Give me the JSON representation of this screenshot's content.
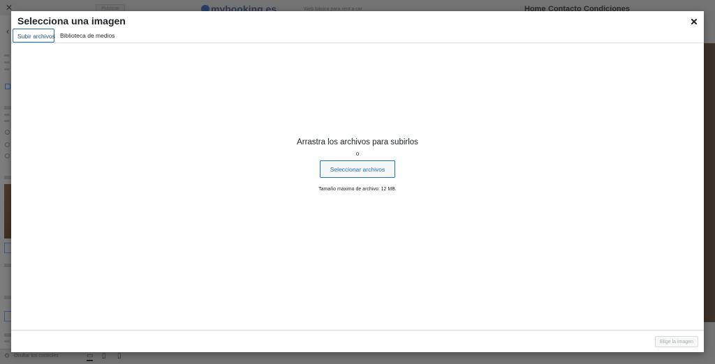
{
  "background": {
    "sidebar": {
      "close_icon": "close-icon",
      "publish_label": "Publicar",
      "back_icon": "chevron-left-icon",
      "hide_controls_label": "Ocultar los controles",
      "settings_icon": "gear-icon",
      "devices": [
        "desktop-icon",
        "tablet-icon",
        "mobile-icon"
      ]
    },
    "preview": {
      "logo": "mybooking.es",
      "tagline": "Web básica para rent a car",
      "nav": [
        "Home",
        "Contacto",
        "Condiciones"
      ]
    }
  },
  "modal": {
    "title": "Selecciona una imagen",
    "close_icon": "close-icon",
    "tabs": [
      {
        "label": "Subir archivos",
        "active": true
      },
      {
        "label": "Biblioteca de medios",
        "active": false
      }
    ],
    "upload": {
      "drop_text": "Arrastra los archivos para subirlos",
      "or_text": "o",
      "select_button": "Seleccionar archivos",
      "max_size": "Tamaño máximo de archivo: 12 MB."
    },
    "toolbar": {
      "choose_button": "Elige la imagen",
      "choose_button_disabled": true
    }
  },
  "colors": {
    "accent": "#2271b1",
    "overlay": "#6b6b6b",
    "border": "#dcdcde"
  }
}
